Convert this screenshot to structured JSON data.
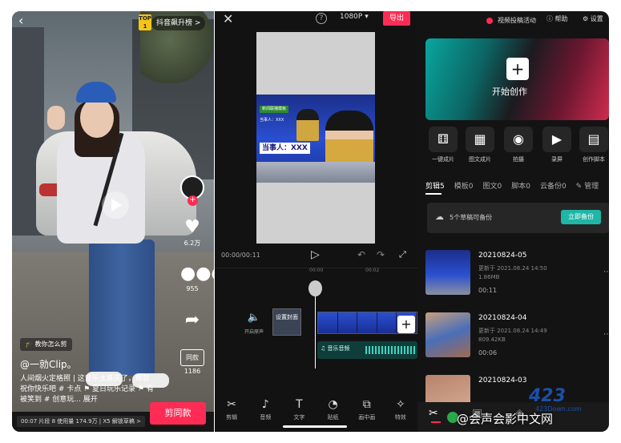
{
  "douyin": {
    "rank_badge": "TOP\n1",
    "rank_label": "抖音飙升榜 >",
    "likes": "6.2万",
    "comments": "955",
    "collect_label": "同款",
    "collect_count": "1186",
    "tutorial": "教你怎么剪",
    "username": "@一勍Clip。",
    "caption": "人间烟火定格照 | 这音乐太喜庆了，那就祝你快乐吧 # 卡点 ⚑ 夏日玩乐记录 ⚑ 有被笑到 # 创意玩... 展开",
    "bottom_info": "00:07 片段 8 使用量 174.9万 | X5 解锁草稿 >",
    "same_button": "剪同款"
  },
  "editor": {
    "resolution": "1080P ▾",
    "export_label": "导出",
    "news_label": "新闻联播模板",
    "news_name": "当事人：XXX",
    "news_big": "当事人：XXX",
    "time": "00:00/00:11",
    "ticks": [
      "00:00",
      "00:02"
    ],
    "mute_label": "开启原声",
    "cover_label": "设置封面",
    "music_label": "♫ 音乐音频",
    "tools": [
      {
        "icon": "✂",
        "label": "剪辑"
      },
      {
        "icon": "♪",
        "label": "音频"
      },
      {
        "icon": "T",
        "label": "文字"
      },
      {
        "icon": "◔",
        "label": "贴纸"
      },
      {
        "icon": "⧉",
        "label": "画中画"
      },
      {
        "icon": "✧",
        "label": "特效"
      }
    ]
  },
  "home": {
    "promo": "视频投稿活动",
    "help": "帮助",
    "settings": "设置",
    "create_label": "开始创作",
    "shortcuts": [
      {
        "icon": "⚅",
        "label": "一键成片"
      },
      {
        "icon": "▦",
        "label": "图文成片"
      },
      {
        "icon": "◉",
        "label": "拍摄"
      },
      {
        "icon": "▶",
        "label": "录屏"
      },
      {
        "icon": "▤",
        "label": "创作脚本"
      }
    ],
    "tabs": [
      "剪辑5",
      "模板0",
      "图文0",
      "脚本0",
      "云备份0",
      "✎ 管理"
    ],
    "backup_text": "5个草稿可备份",
    "backup_button": "立即备份",
    "drafts": [
      {
        "title": "20210824-05",
        "updated": "更新于 2021.08.24 14:50",
        "size": "1.86MB",
        "duration": "00:11"
      },
      {
        "title": "20210824-04",
        "updated": "更新于 2021.08.24 14:49",
        "size": "809.42KB",
        "duration": "00:06"
      },
      {
        "title": "20210824-03",
        "updated": "",
        "size": "",
        "duration": ""
      }
    ]
  },
  "watermark": {
    "text": "@会声会影中文网",
    "logo": "423",
    "logo_sub": "423Down.com"
  }
}
